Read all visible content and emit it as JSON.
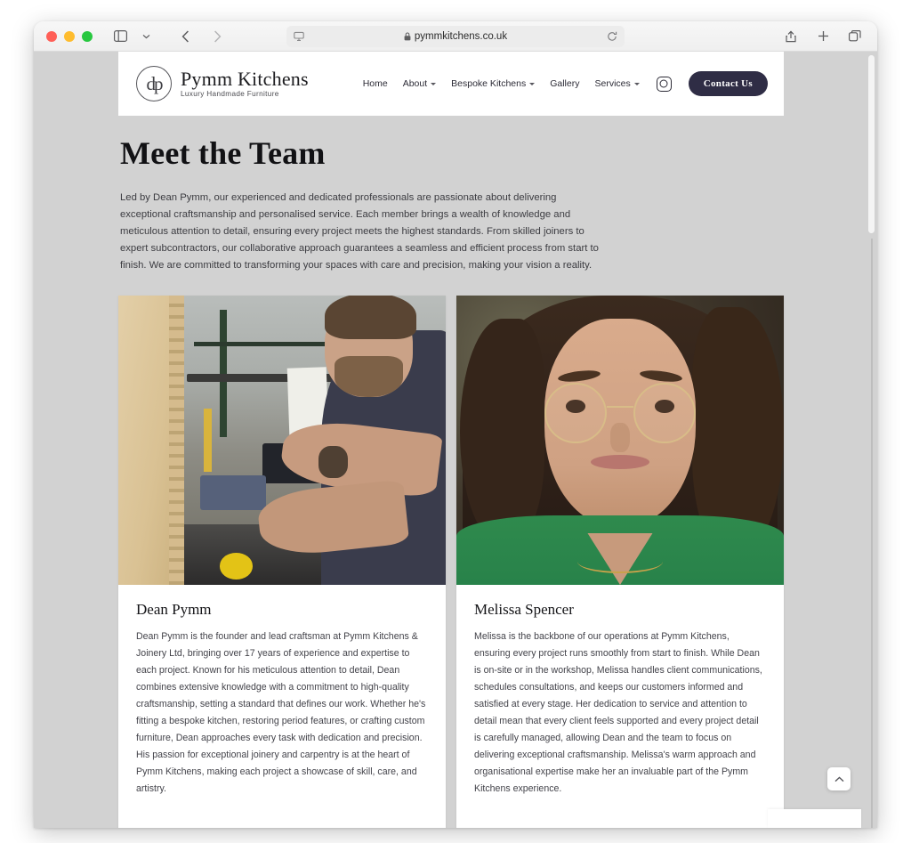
{
  "browser": {
    "url": "pymmkitchens.co.uk",
    "lock_icon": "lock-icon",
    "reader_icon": "reader-view-icon",
    "reload_icon": "reload-icon",
    "sidebar_icon": "sidebar-icon",
    "sidebar_caret_icon": "chevron-down-icon",
    "back_icon": "back-chevron-icon",
    "forward_icon": "forward-chevron-icon",
    "share_icon": "share-icon",
    "newtab_icon": "plus-icon",
    "tabs_icon": "tab-overview-icon",
    "traffic_lights": [
      "close-red",
      "minimize-amber",
      "zoom-green"
    ]
  },
  "site": {
    "logo": {
      "monogram": "dp",
      "name": "Pymm Kitchens",
      "tagline": "Luxury Handmade Furniture"
    },
    "nav": [
      {
        "label": "Home",
        "has_caret": false
      },
      {
        "label": "About",
        "has_caret": true
      },
      {
        "label": "Bespoke Kitchens",
        "has_caret": true
      },
      {
        "label": "Gallery",
        "has_caret": false
      },
      {
        "label": "Services",
        "has_caret": true
      }
    ],
    "instagram_icon": "instagram-icon",
    "contact_button": "Contact Us",
    "contact_button_color": "#2f2d45"
  },
  "main": {
    "title": "Meet the Team",
    "intro": "Led by Dean Pymm, our experienced and dedicated professionals are passionate about delivering exceptional craftsmanship and personalised service. Each member brings a wealth of knowledge and meticulous attention to detail, ensuring every project meets the highest standards. From skilled joiners to expert subcontractors, our collaborative approach guarantees a seamless and efficient process from start to finish. We are committed to transforming your spaces with care and precision, making your vision a reality.",
    "team": [
      {
        "name": "Dean Pymm",
        "photo_alt": "dean-pymm-workshop-photo",
        "bio": "Dean Pymm is the founder and lead craftsman at Pymm Kitchens & Joinery Ltd, bringing over 17 years of experience and expertise to each project. Known for his meticulous attention to detail, Dean combines extensive knowledge with a commitment to high-quality craftsmanship, setting a standard that defines our work. Whether he's fitting a bespoke kitchen, restoring period features, or crafting custom furniture, Dean approaches every task with dedication and precision. His passion for exceptional joinery and carpentry is at the heart of Pymm Kitchens, making each project a showcase of skill, care, and artistry."
      },
      {
        "name": "Melissa Spencer",
        "photo_alt": "melissa-spencer-portrait-photo",
        "bio": "Melissa is the backbone of our operations at Pymm Kitchens, ensuring every project runs smoothly from start to finish. While Dean is on-site or in the workshop, Melissa handles client communications, schedules consultations, and keeps our customers informed and satisfied at every stage. Her dedication to service and attention to detail mean that every client feels supported and every project detail is carefully managed, allowing Dean and the team to focus on delivering exceptional craftsmanship. Melissa's warm approach and organisational expertise make her an invaluable part of the Pymm Kitchens experience."
      }
    ]
  },
  "widgets": {
    "scroll_top_icon": "chevron-up-icon"
  }
}
